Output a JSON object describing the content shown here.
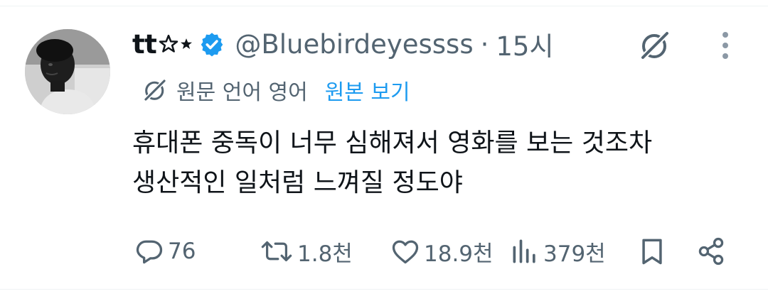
{
  "user": {
    "display_name": "tt",
    "handle": "@Bluebirdeyessss",
    "separator": "·",
    "time": "15시"
  },
  "translation": {
    "language_note": "원문 언어 영어",
    "show_original_label": "원본 보기"
  },
  "tweet": {
    "lines": [
      "휴대폰 중독이 너무 심해져서 영화를 보는 것조차",
      "생산적인 일처럼 느껴질 정도야"
    ]
  },
  "actions": {
    "replies": "76",
    "retweets": "1.8천",
    "likes": "18.9천",
    "views": "379천"
  },
  "colors": {
    "text": "#0f1419",
    "secondary": "#536471",
    "accent": "#1d9bf0",
    "verified": "#1d9bf0",
    "divider": "#eff3f4"
  },
  "icons": {
    "verified": "verified-badge-icon",
    "grok": "grok-icon",
    "more": "more-vertical-icon",
    "translate": "translate-icon",
    "reply": "reply-icon",
    "retweet": "retweet-icon",
    "like": "heart-icon",
    "views": "views-bar-icon",
    "bookmark": "bookmark-icon",
    "share": "share-icon"
  }
}
